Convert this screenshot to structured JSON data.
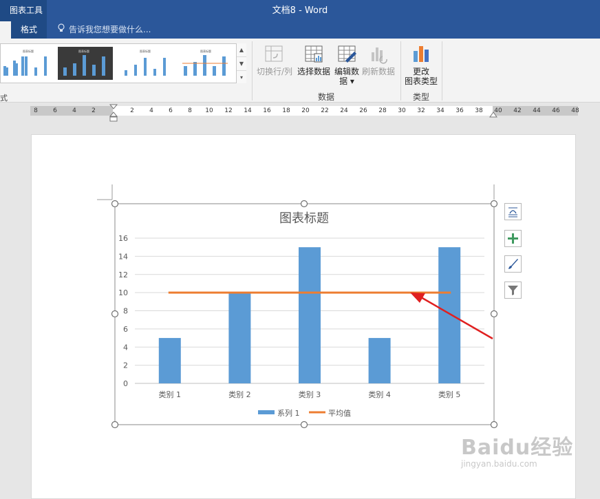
{
  "window": {
    "title": "文档8 - Word",
    "context_tab_group": "图表工具",
    "active_tab": "格式",
    "tell_me_placeholder": "告诉我您想要做什么...",
    "colors": {
      "titlebar": "#2b579a",
      "accent_dark": "#1f4a85"
    }
  },
  "ribbon": {
    "groups": [
      {
        "label": "数据",
        "buttons": [
          {
            "label": "切换行/列",
            "enabled": false,
            "icon": "switch-row-column-icon"
          },
          {
            "label": "选择数据",
            "enabled": true,
            "icon": "select-data-icon"
          },
          {
            "label": "编辑数\n据",
            "label_line1": "编辑数",
            "label_line2": "据 ▾",
            "enabled": true,
            "icon": "edit-data-icon"
          },
          {
            "label": "刷新数据",
            "enabled": false,
            "icon": "refresh-data-icon"
          }
        ]
      },
      {
        "label": "类型",
        "buttons": [
          {
            "label_line1": "更改",
            "label_line2": "图表类型",
            "enabled": true,
            "icon": "change-chart-type-icon"
          }
        ]
      }
    ],
    "left_group_label_fragment": "式"
  },
  "ruler": {
    "ticks": [
      "8",
      "6",
      "4",
      "2",
      "2",
      "4",
      "6",
      "8",
      "10",
      "12",
      "14",
      "16",
      "18",
      "20",
      "22",
      "24",
      "26",
      "28",
      "30",
      "32",
      "34",
      "36",
      "38",
      "40",
      "42",
      "44",
      "46",
      "48"
    ]
  },
  "chart_data": {
    "type": "bar",
    "title": "图表标题",
    "categories": [
      "类别 1",
      "类别 2",
      "类别 3",
      "类别 4",
      "类别 5"
    ],
    "series": [
      {
        "name": "系列 1",
        "type": "bar",
        "values": [
          5,
          10,
          15,
          5,
          15
        ],
        "color": "#5b9bd5"
      },
      {
        "name": "平均值",
        "type": "line",
        "values": [
          10,
          10,
          10,
          10,
          10
        ],
        "color": "#ed7d31"
      }
    ],
    "ylim": [
      0,
      16
    ],
    "yticks": [
      "0",
      "2",
      "4",
      "6",
      "8",
      "10",
      "12",
      "14",
      "16"
    ],
    "grid": true,
    "legend": "bottom",
    "xlabel": "",
    "ylabel": ""
  },
  "annotation": {
    "type": "arrow",
    "color": "#e02020",
    "points_to": "平均值"
  },
  "watermark": {
    "logo": "Baidu经验",
    "url": "jingyan.baidu.com"
  }
}
